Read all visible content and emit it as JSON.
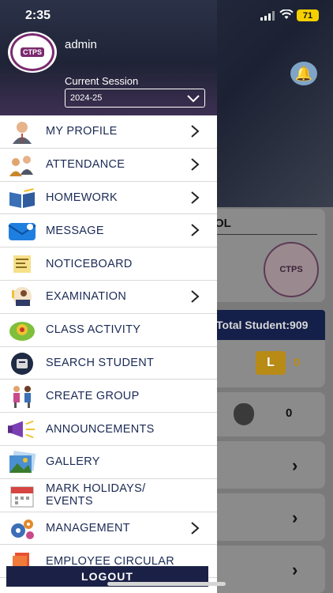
{
  "status_bar": {
    "time": "2:35",
    "battery": "71"
  },
  "drawer": {
    "user_name": "admin",
    "avatar_text": "CTPS",
    "session_label": "Current Session",
    "session_value": "2024-25",
    "menu": [
      {
        "label": "MY PROFILE",
        "icon": "profile-icon",
        "arrow": true
      },
      {
        "label": "ATTENDANCE",
        "icon": "attendance-icon",
        "arrow": true
      },
      {
        "label": "HOMEWORK",
        "icon": "homework-icon",
        "arrow": true
      },
      {
        "label": "MESSAGE",
        "icon": "message-icon",
        "arrow": true
      },
      {
        "label": "NOTICEBOARD",
        "icon": "noticeboard-icon",
        "arrow": false
      },
      {
        "label": "EXAMINATION",
        "icon": "examination-icon",
        "arrow": true
      },
      {
        "label": "CLASS ACTIVITY",
        "icon": "class-activity-icon",
        "arrow": false
      },
      {
        "label": "SEARCH STUDENT",
        "icon": "search-student-icon",
        "arrow": false
      },
      {
        "label": "CREATE GROUP",
        "icon": "create-group-icon",
        "arrow": false
      },
      {
        "label": "ANNOUNCEMENTS",
        "icon": "megaphone-icon",
        "arrow": false
      },
      {
        "label": "GALLERY",
        "icon": "gallery-icon",
        "arrow": false
      },
      {
        "label": "MARK HOLIDAYS/\nEVENTS",
        "icon": "calendar-icon",
        "arrow": false
      },
      {
        "label": "MANAGEMENT",
        "icon": "gears-icon",
        "arrow": true
      },
      {
        "label": "EMPLOYEE CIRCULAR",
        "icon": "circular-icon",
        "arrow": false
      }
    ],
    "logout_label": "LOGOUT"
  },
  "background": {
    "school_title_fragment": "OL",
    "school_logo_text": "CTPS",
    "total_student": "Total Student:909",
    "leave_badge": "L",
    "leave_value": "0",
    "apple_value": "0"
  }
}
